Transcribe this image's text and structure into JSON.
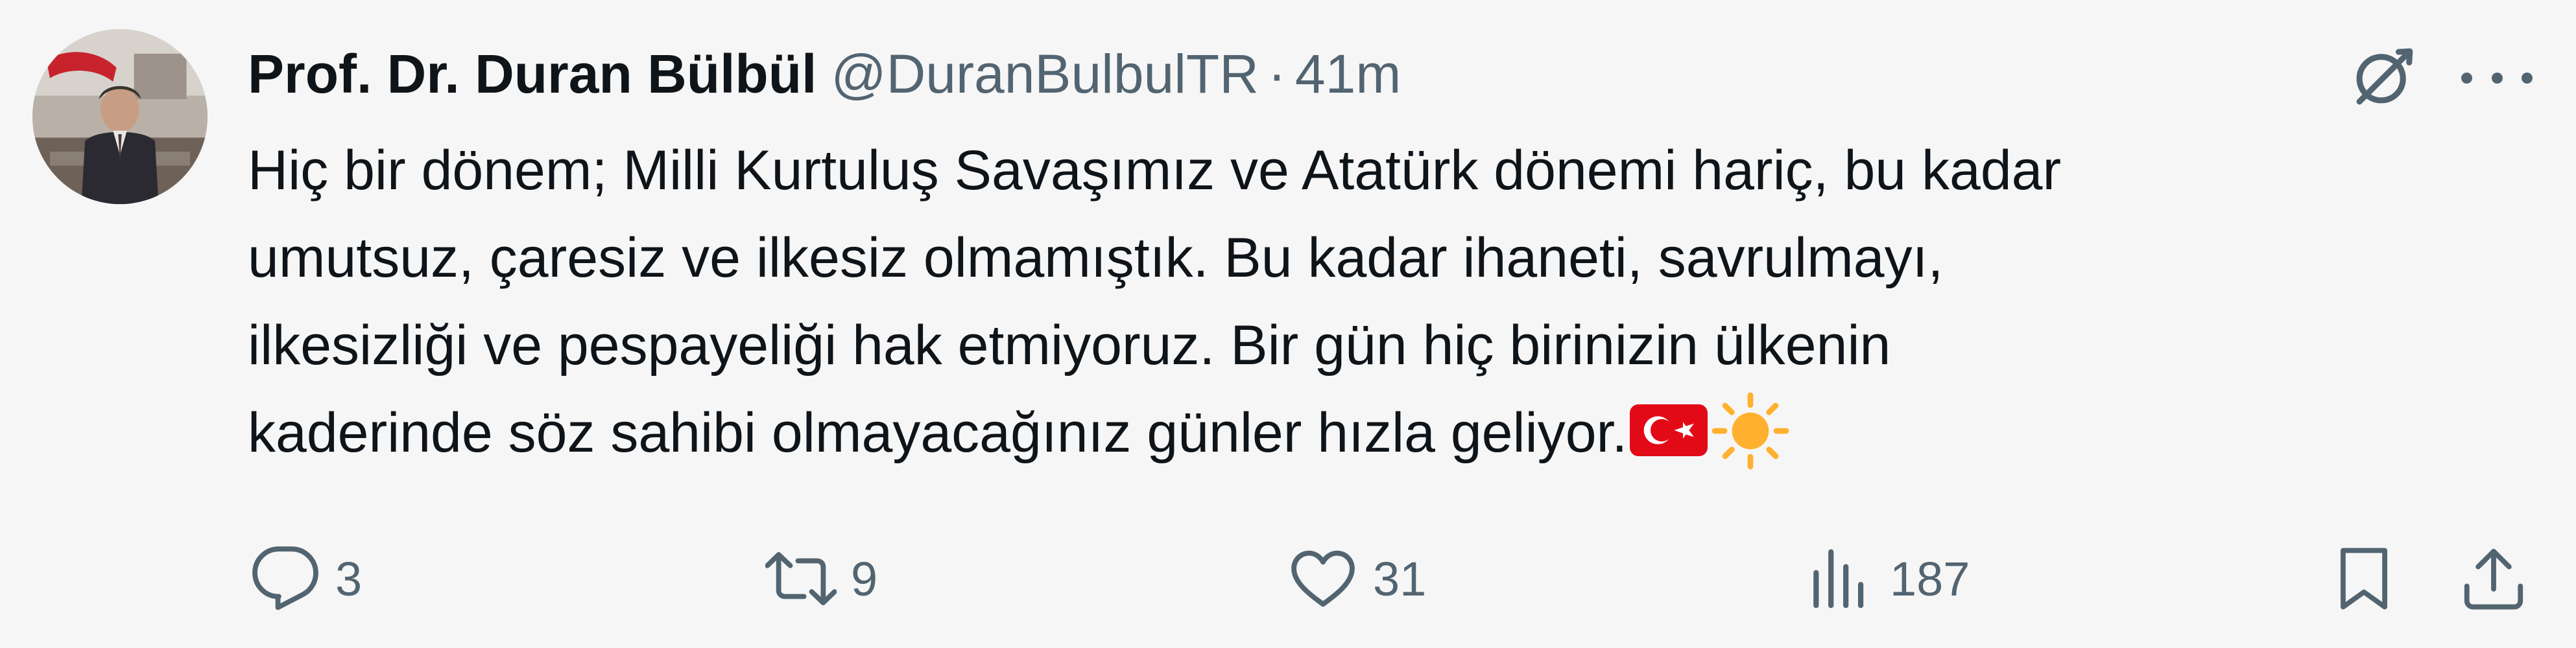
{
  "author": {
    "name": "Prof. Dr. Duran Bülbül",
    "handle": "@DuranBulbulTR",
    "separator": "·",
    "time": "41m"
  },
  "tweet": {
    "lines": [
      "Hiç bir dönem; Milli Kurtuluş Savaşımız ve Atatürk dönemi hariç, bu kadar",
      "umutsuz, çaresiz ve ilkesiz olmamıştık.  Bu kadar ihaneti, savrulmayı,",
      "ilkesizliği ve pespayeliği hak etmiyoruz. Bir gün hiç birinizin ülkenin",
      "kaderinde söz sahibi olmayacağınız günler hızla geliyor."
    ],
    "emojis": [
      "turkey-flag",
      "sun"
    ]
  },
  "actions": {
    "reply_count": "3",
    "retweet_count": "9",
    "like_count": "31",
    "views_count": "187"
  },
  "icons": {
    "grok": "grok-icon",
    "more": "more-icon",
    "reply": "reply-icon",
    "retweet": "retweet-icon",
    "like": "heart-icon",
    "views": "views-icon",
    "bookmark": "bookmark-icon",
    "share": "share-icon"
  },
  "colors": {
    "background": "#f6f6f6",
    "text_primary": "#0f1419",
    "text_secondary": "#536471",
    "flag_red": "#e30a17",
    "sun": "#ffb02e"
  }
}
